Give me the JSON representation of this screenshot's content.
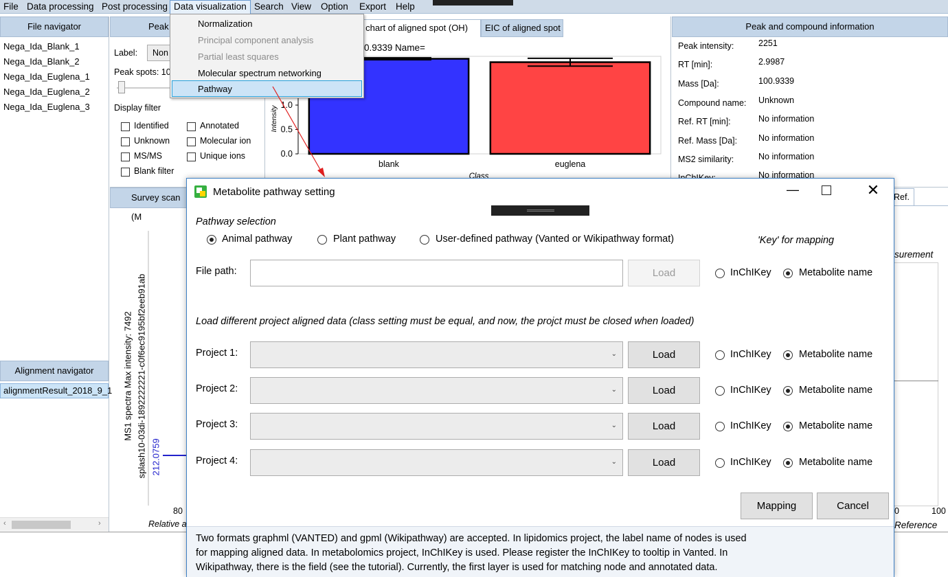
{
  "menubar": {
    "items": [
      "File",
      "Data processing",
      "Post processing",
      "Data visualization",
      "Search",
      "View",
      "Option",
      "Export",
      "Help"
    ]
  },
  "file_navigator": {
    "title": "File navigator",
    "files": [
      "Nega_Ida_Blank_1",
      "Nega_Ida_Blank_2",
      "Nega_Ida_Euglena_1",
      "Nega_Ida_Euglena_2",
      "Nega_Ida_Euglena_3"
    ]
  },
  "alignment_navigator": {
    "title": "Alignment navigator",
    "item": "alignmentResult_2018_9_1"
  },
  "peak_panel": {
    "header": "Peak",
    "label_text": "Label:",
    "label_value": "Non",
    "peak_spots_text": "Peak spots: 10",
    "display_filter": "Display filter",
    "filters": [
      "Identified",
      "Annotated",
      "Unknown",
      "Molecular ion",
      "MS/MS",
      "Unique ions",
      "Blank filter"
    ]
  },
  "chart_tabs": {
    "tab1": "ar chart of aligned spot (OH)",
    "tab2": "EIC of aligned spot"
  },
  "chart_data": {
    "type": "bar",
    "title": "0.9339 Name=",
    "categories": [
      "blank",
      "euglena"
    ],
    "values": [
      1.95,
      1.88
    ],
    "errors": [
      0.02,
      0.08
    ],
    "colors": [
      "#3333ff",
      "#ff4444"
    ],
    "xlabel": "Class",
    "ylabel": "Intensity",
    "ytick_labels": [
      "1.5",
      "1.0",
      "0.5",
      "0.0"
    ],
    "ylim": [
      0,
      2
    ]
  },
  "survey": {
    "tab": "Survey scan (M",
    "ylabel1": "MS1 spectra Max intensity: 7492",
    "ylabel2": "splash10-03di-1892222221-c0f6ec9195bf2eeb91ab",
    "peak_label": "212.0759",
    "tick": "80",
    "xlabel": "Relative a"
  },
  "right_partial": {
    "ref_tab": "Ref.",
    "measurement": "surement",
    "tick0": "0",
    "tick100": "100",
    "reference": "Reference"
  },
  "peak_info": {
    "title": "Peak and compound information",
    "rows": [
      {
        "key": "Peak intensity:",
        "value": "2251"
      },
      {
        "key": "RT [min]:",
        "value": "2.9987"
      },
      {
        "key": "Mass [Da]:",
        "value": "100.9339"
      },
      {
        "key": "Compound name:",
        "value": "Unknown"
      },
      {
        "key": "Ref. RT [min]:",
        "value": "No information"
      },
      {
        "key": "Ref. Mass [Da]:",
        "value": "No information"
      },
      {
        "key": "MS2 similarity:",
        "value": "No information"
      },
      {
        "key": "InChIKey:",
        "value": "No information"
      }
    ]
  },
  "dropdown": {
    "items": [
      {
        "label": "Normalization",
        "disabled": false
      },
      {
        "label": "Principal component analysis",
        "disabled": true
      },
      {
        "label": "Partial least squares",
        "disabled": true
      },
      {
        "label": "Molecular spectrum networking",
        "disabled": false
      },
      {
        "label": "Pathway",
        "disabled": false,
        "highlighted": true
      }
    ]
  },
  "dialog": {
    "title": "Metabolite pathway setting",
    "pathway_selection": "Pathway selection",
    "radios": [
      "Animal pathway",
      "Plant pathway",
      "User-defined pathway (Vanted or Wikipathway format)"
    ],
    "selected_pathway": "Animal pathway",
    "key_mapping": "'Key' for mapping",
    "file_path_label": "File path:",
    "file_path_value": "",
    "load": "Load",
    "inchikey": "InChIKey",
    "metabolite_name": "Metabolite name",
    "load_diff": "Load different project aligned data (class setting must be equal, and now, the projct must be closed when loaded)",
    "projects": [
      "Project 1:",
      "Project 2:",
      "Project 3:",
      "Project 4:"
    ],
    "mapping": "Mapping",
    "cancel": "Cancel",
    "info_lines": [
      "Two formats graphml (VANTED) and gpml (Wikipathway) are accepted. In lipidomics project, the label name of nodes is used",
      "for mapping aligned data. In metabolomics project, InChIKey is used. Please register the InChIKey to tooltip in Vanted. In",
      "Wikipathway, there is the field (see the tutorial). Currently, the first layer is used for matching node and annotated data."
    ]
  }
}
